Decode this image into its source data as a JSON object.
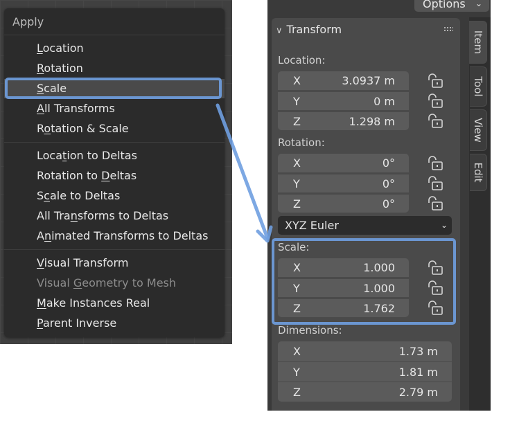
{
  "apply_menu": {
    "title": "Apply",
    "items": [
      {
        "label": "Location",
        "ul": "L",
        "rest": "ocation"
      },
      {
        "label": "Rotation",
        "ul": "R",
        "rest": "otation"
      },
      {
        "label": "Scale",
        "ul": "S",
        "rest": "cale"
      },
      {
        "label": "All Transforms",
        "ul": "A",
        "rest": "ll Transforms"
      },
      {
        "label": "Rotation & Scale",
        "pre": "R",
        "ul": "o",
        "rest": "tation & Scale"
      },
      {
        "label": "Location to Deltas",
        "pre": "Loca",
        "ul": "t",
        "rest": "ion to Deltas"
      },
      {
        "label": "Rotation to Deltas",
        "pre": "Rotation to ",
        "ul": "D",
        "rest": "eltas"
      },
      {
        "label": "Scale to Deltas",
        "pre": "S",
        "ul": "c",
        "rest": "ale to Deltas"
      },
      {
        "label": "All Transforms to Deltas",
        "pre": "All Tra",
        "ul": "n",
        "rest": "sforms to Deltas"
      },
      {
        "label": "Animated Transforms to Deltas",
        "pre": "A",
        "ul": "n",
        "rest": "imated Transforms to Deltas"
      },
      {
        "label": "Visual Transform",
        "ul": "V",
        "rest": "isual Transform"
      },
      {
        "label": "Visual Geometry to Mesh",
        "pre": "Visual ",
        "ul": "G",
        "rest": "eometry to Mesh"
      },
      {
        "label": "Make Instances Real",
        "ul": "M",
        "rest": "ake Instances Real"
      },
      {
        "label": "Parent Inverse",
        "ul": "P",
        "rest": "arent Inverse"
      }
    ]
  },
  "header": {
    "options_label": "Options"
  },
  "transform": {
    "title": "Transform",
    "location": {
      "label": "Location:",
      "x": "3.0937 m",
      "y": "0 m",
      "z": "1.298 m"
    },
    "rotation": {
      "label": "Rotation:",
      "x": "0°",
      "y": "0°",
      "z": "0°"
    },
    "rotation_mode": "XYZ Euler",
    "scale": {
      "label": "Scale:",
      "x": "1.000",
      "y": "1.000",
      "z": "1.762"
    },
    "dimensions": {
      "label": "Dimensions:",
      "x": "1.73 m",
      "y": "1.81 m",
      "z": "2.79 m"
    },
    "axes": {
      "x": "X",
      "y": "Y",
      "z": "Z"
    }
  },
  "tabs": [
    "Item",
    "Tool",
    "View",
    "Edit"
  ],
  "colors": {
    "highlight": "#6f9fe0",
    "menu_bg": "#2b2b2b",
    "panel_bg": "#4a4a4a",
    "field_bg": "#5b5b5b"
  }
}
